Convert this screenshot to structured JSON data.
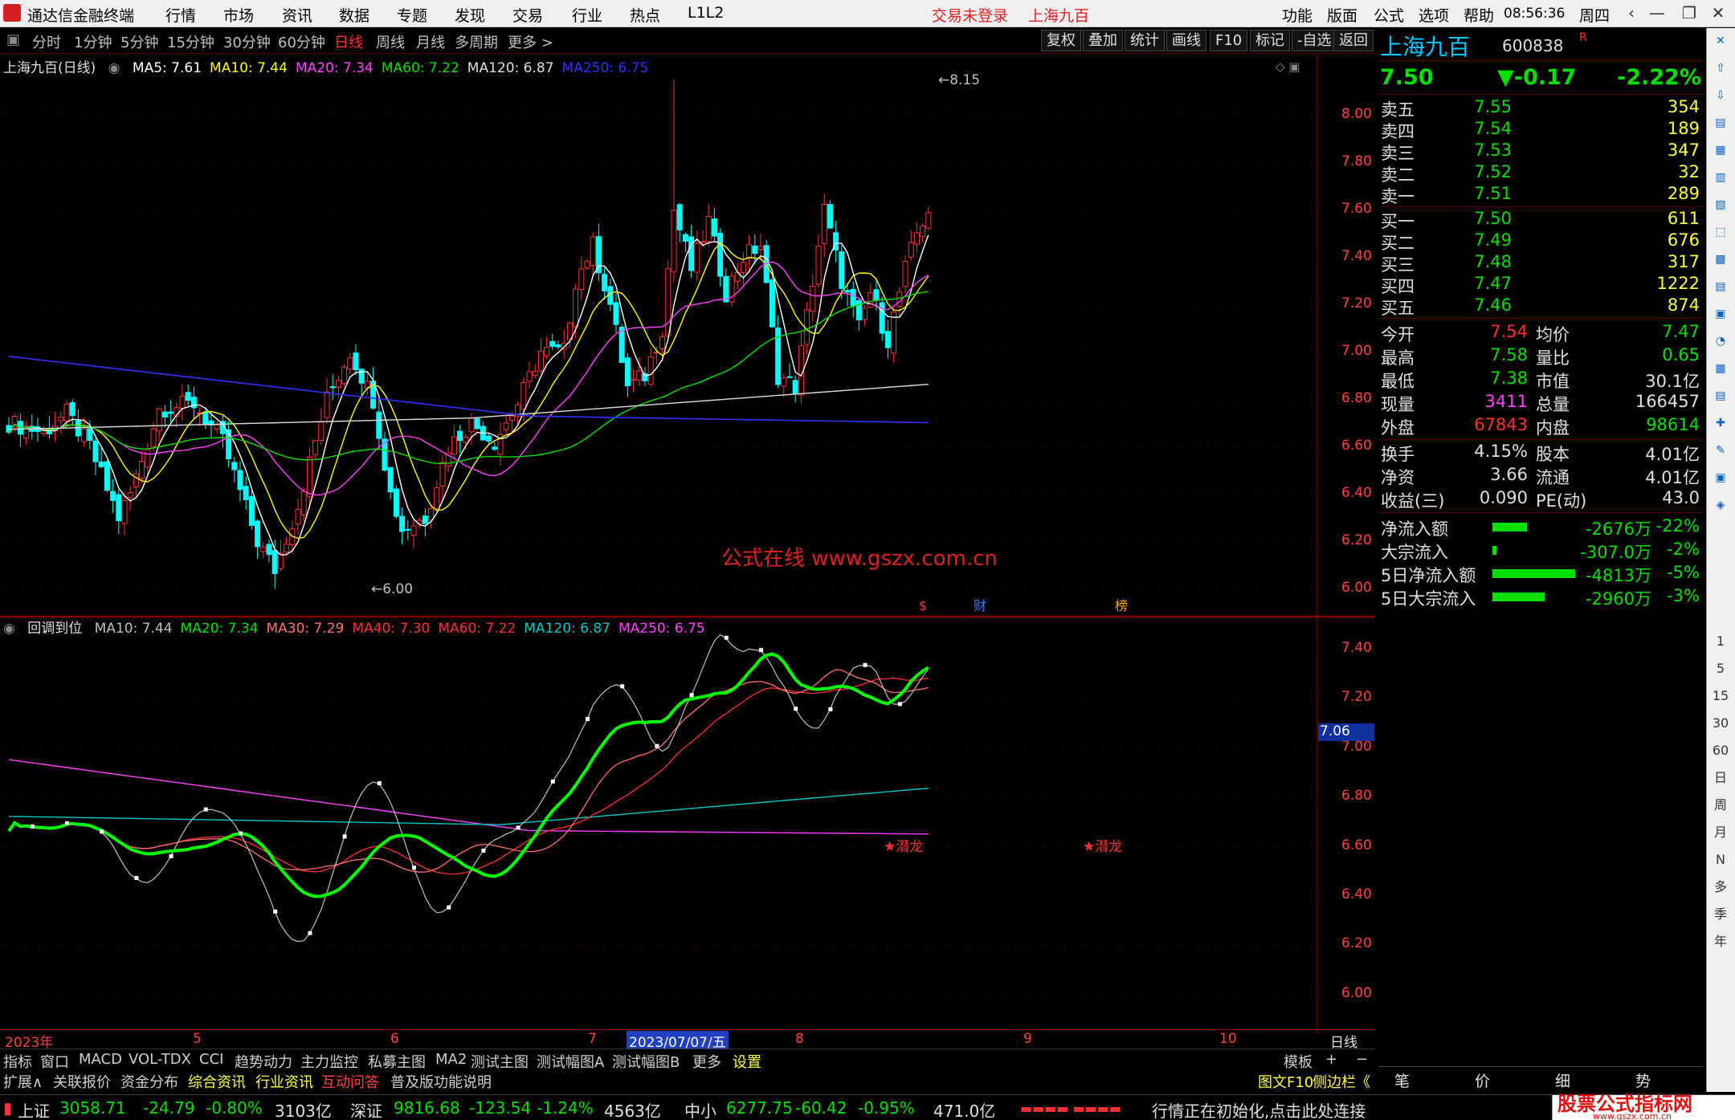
{
  "app": {
    "title": "通达信金融终端",
    "login_status": "交易未登录",
    "stock_title": "上海九百",
    "clock": "08:56:36",
    "weekday": "周四"
  },
  "menu": {
    "items": [
      "行情",
      "市场",
      "资讯",
      "数据",
      "专题",
      "发现",
      "交易",
      "行业",
      "热点",
      "L1L2"
    ],
    "right_items": [
      "功能",
      "版面",
      "公式",
      "选项",
      "帮助"
    ]
  },
  "periods": [
    "分时",
    "1分钟",
    "5分钟",
    "15分钟",
    "30分钟",
    "60分钟",
    "日线",
    "周线",
    "月线",
    "多周期",
    "更多 >"
  ],
  "selected_period": "日线",
  "toolbar_right": [
    "复权",
    "叠加",
    "统计",
    "画线",
    "F10",
    "标记",
    "-自选",
    "返回"
  ],
  "main_chart": {
    "label": "上海九百(日线)",
    "ma": [
      {
        "t": "MA5: 7.61",
        "c": "#ffffff"
      },
      {
        "t": "MA10: 7.44",
        "c": "#ffff00"
      },
      {
        "t": "MA20: 7.34",
        "c": "#ff40ff"
      },
      {
        "t": "MA60: 7.22",
        "c": "#00e000"
      },
      {
        "t": "MA120: 6.87",
        "c": "#e0e0e0"
      },
      {
        "t": "MA250: 6.75",
        "c": "#3030ff"
      }
    ],
    "axis": [
      "8.00",
      "7.80",
      "7.60",
      "7.40",
      "7.20",
      "7.00",
      "6.80",
      "6.60",
      "6.40",
      "6.20",
      "6.00"
    ],
    "high_label": "8.15",
    "low_label": "6.00",
    "watermark": "公式在线  www.gszx.com.cn",
    "markers": [
      "$",
      "财",
      "榜"
    ]
  },
  "sub_chart": {
    "label": "回调到位",
    "ma": [
      {
        "t": "MA10: 7.44",
        "c": "#c0c0c0"
      },
      {
        "t": "MA20: 7.34",
        "c": "#00e000"
      },
      {
        "t": "MA30: 7.29",
        "c": "#ff7070"
      },
      {
        "t": "MA40: 7.30",
        "c": "#ff3030"
      },
      {
        "t": "MA60: 7.22",
        "c": "#ff3030"
      },
      {
        "t": "MA120: 6.87",
        "c": "#00c8c8"
      },
      {
        "t": "MA250: 6.75",
        "c": "#ff40ff"
      }
    ],
    "axis": [
      "7.40",
      "7.20",
      "7.00",
      "6.80",
      "6.60",
      "6.40",
      "6.20",
      "6.00"
    ],
    "current": "7.06",
    "signal": "★潜龙"
  },
  "date_axis": {
    "labels": [
      "2023年",
      "5",
      "6",
      "7",
      "2023/07/07/五",
      "8",
      "9",
      "10"
    ],
    "mode": "日线"
  },
  "bottom_tabs": [
    "指标",
    "窗口",
    "MACD",
    "VOL-TDX",
    "CCI",
    "趋势动力",
    "主力监控",
    "私募主图",
    "MA2",
    "测试主图",
    "测试幅图A",
    "测试幅图B",
    "更多",
    "设置"
  ],
  "bottom_tabs_right": [
    "模板",
    "+",
    "−"
  ],
  "bottom_tabs2": [
    {
      "t": "扩展∧",
      "c": "#d0d0d0"
    },
    {
      "t": "关联报价",
      "c": "#d0d0d0"
    },
    {
      "t": "资金分布",
      "c": "#d0d0d0"
    },
    {
      "t": "综合资讯",
      "c": "#ffff40"
    },
    {
      "t": "行业资讯",
      "c": "#ffff40"
    },
    {
      "t": "互动问答",
      "c": "#ff4040"
    },
    {
      "t": "普及版功能说明",
      "c": "#d0d0d0"
    }
  ],
  "bottom_tabs2_right": [
    "图文F10",
    "侧边栏《"
  ],
  "quote": {
    "name": "上海九百",
    "code": "600838",
    "badge": "R",
    "price": "7.50",
    "change": "▼-0.17",
    "pct": "-2.22%",
    "asks": [
      [
        "卖五",
        "7.55",
        "354"
      ],
      [
        "卖四",
        "7.54",
        "189"
      ],
      [
        "卖三",
        "7.53",
        "347"
      ],
      [
        "卖二",
        "7.52",
        "32"
      ],
      [
        "卖一",
        "7.51",
        "289"
      ]
    ],
    "bids": [
      [
        "买一",
        "7.50",
        "611"
      ],
      [
        "买二",
        "7.49",
        "676"
      ],
      [
        "买三",
        "7.48",
        "317"
      ],
      [
        "买四",
        "7.47",
        "1222"
      ],
      [
        "买五",
        "7.46",
        "874"
      ]
    ],
    "stats": [
      [
        "今开",
        "7.54",
        "red",
        "均价",
        "7.47",
        "green"
      ],
      [
        "最高",
        "7.58",
        "green",
        "量比",
        "0.65",
        "green"
      ],
      [
        "最低",
        "7.38",
        "green",
        "市值",
        "30.1亿",
        "white"
      ],
      [
        "现量",
        "3411",
        "mag",
        "总量",
        "166457",
        "white"
      ],
      [
        "外盘",
        "67843",
        "red",
        "内盘",
        "98614",
        "green"
      ],
      [
        "换手",
        "4.15%",
        "white",
        "股本",
        "4.01亿",
        "white"
      ],
      [
        "净资",
        "3.66",
        "white",
        "流通",
        "4.01亿",
        "white"
      ],
      [
        "收益(三)",
        "0.090",
        "white",
        "PE(动)",
        "43.0",
        "white"
      ]
    ],
    "flows": [
      [
        "净流入额",
        "-2676万",
        "-22%",
        0.4
      ],
      [
        "大宗流入",
        "-307.0万",
        "-2%",
        0.05
      ],
      [
        "5日净流入额",
        "-4813万",
        "-5%",
        0.95
      ],
      [
        "5日大宗流入",
        "-2960万",
        "-3%",
        0.6
      ]
    ]
  },
  "side_tabs": [
    "笔",
    "价",
    "细",
    "势"
  ],
  "rtool_labels": [
    "1",
    "5",
    "15",
    "30",
    "60",
    "日",
    "周",
    "月",
    "N",
    "多",
    "季",
    "年"
  ],
  "status": {
    "sh": {
      "n": "上证",
      "p": "3058.71",
      "c": "-24.79",
      "pct": "-0.80%",
      "v": "3103亿"
    },
    "sz": {
      "n": "深证",
      "p": "9816.68",
      "c": "-123.54",
      "pct": "-1.24%",
      "v": "4563亿"
    },
    "zx": {
      "n": "中小",
      "p": "6277.75",
      "c": "-60.42",
      "pct": "-0.95%",
      "v": "471.0亿"
    },
    "msg": "行情正在初始化,点击此处连接",
    "brand": "股票公式指标网",
    "brand_url": "www.gszx.com.cn"
  }
}
